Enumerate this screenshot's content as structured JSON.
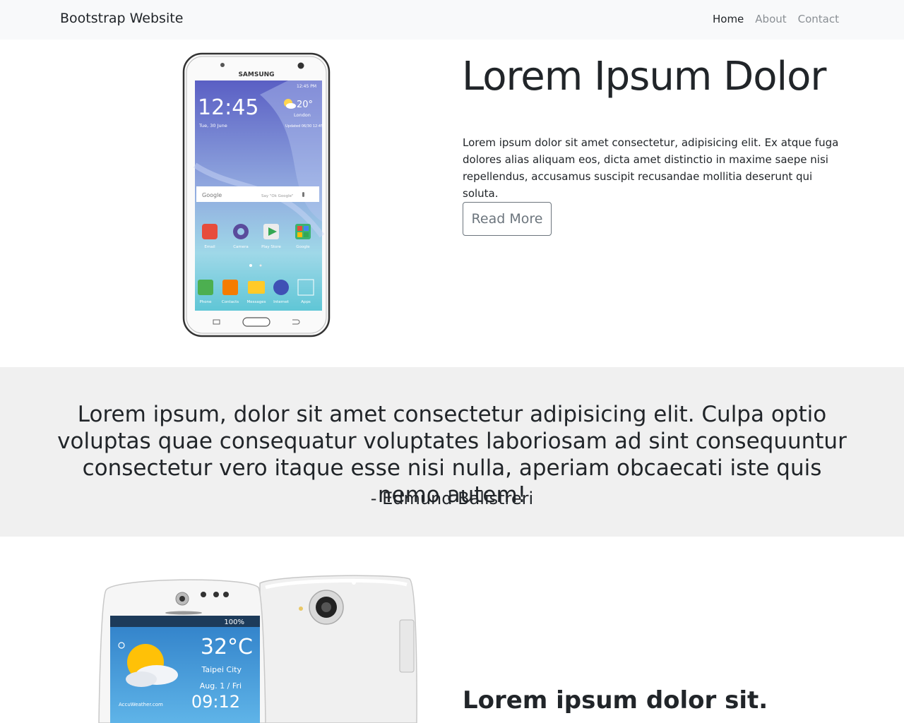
{
  "navbar": {
    "brand": "Bootstrap Website",
    "links": [
      "Home",
      "About",
      "Contact"
    ],
    "active": "Home"
  },
  "hero": {
    "title": "Lorem Ipsum Dolor",
    "text": "Lorem ipsum dolor sit amet consectetur, adipisicing elit. Ex atque fuga dolores alias aliquam eos, dicta amet distinctio in maxime saepe nisi repellendus, accusamus suscipit recusandae mollitia deserunt qui soluta.",
    "button": "Read More",
    "phone": {
      "brand": "SAMSUNG",
      "time": "12:45",
      "date": "Tue, 30 June",
      "status_time": "12:45 PM",
      "weather_temp": "20°",
      "weather_city": "London",
      "weather_updated": "Updated 06/30 12:45",
      "search_label": "Google",
      "search_hint": "Say \"Ok Google\"",
      "apps": [
        "Email",
        "Camera",
        "Play Store",
        "Google"
      ],
      "dock": [
        "Phone",
        "Contacts",
        "Messages",
        "Internet",
        "Apps"
      ]
    }
  },
  "quote": {
    "text": "Lorem ipsum, dolor sit amet consectetur adipisicing elit. Culpa optio voluptas quae consequatur voluptates laboriosam ad sint consequuntur consectetur vero itaque esse nisi nulla, aperiam obcaecati iste quis nemo autem!",
    "author": "- Edmund Balistreri"
  },
  "section2": {
    "title": "Lorem ipsum dolor sit.",
    "phone": {
      "battery": "100%",
      "temp": "32°C",
      "city": "Taipei City",
      "date": "Aug. 1 / Fri",
      "time": "09:12",
      "widget_brand": "AccuWeather.com"
    }
  },
  "colors": {
    "navbar_bg": "#f8f9fa",
    "quote_bg": "#f0f0f0",
    "text": "#212529",
    "muted": "#6c757d"
  }
}
